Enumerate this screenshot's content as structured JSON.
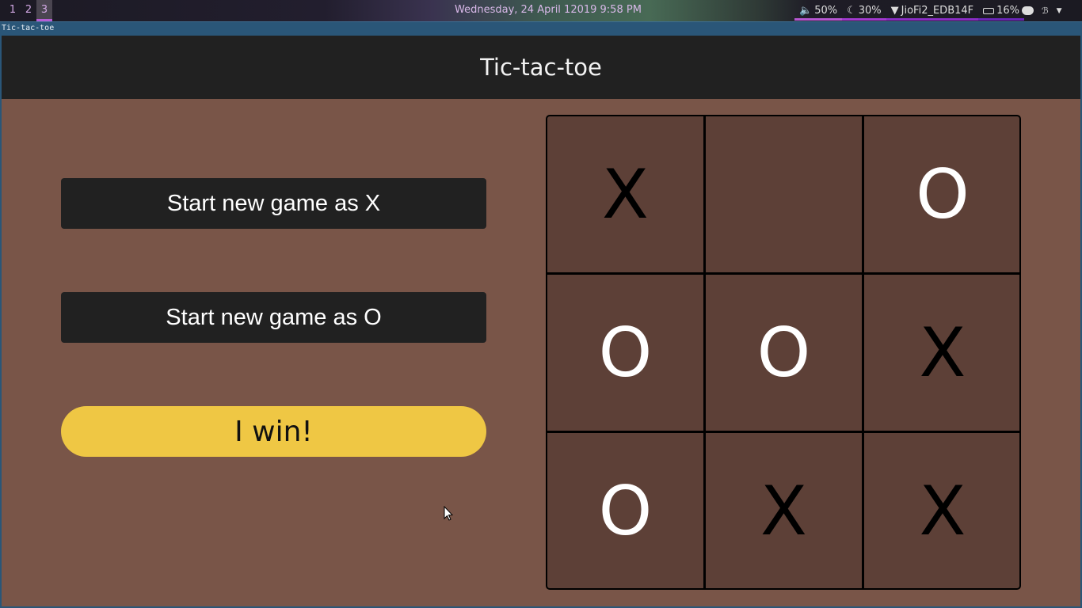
{
  "system_bar": {
    "workspaces": [
      {
        "label": "1",
        "active": false
      },
      {
        "label": "2",
        "active": false
      },
      {
        "label": "3",
        "active": true
      }
    ],
    "clock": "Wednesday, 24 April 12019  9:58 PM",
    "tray": {
      "volume": "50%",
      "brightness": "30%",
      "wifi": "JioFi2_EDB14F",
      "battery": "16%"
    },
    "colors": {
      "accent": "#b65ed6",
      "text": "#d6b6e6"
    }
  },
  "window": {
    "title": "Tic-tac-toe"
  },
  "app": {
    "header_title": "Tic-tac-toe",
    "buttons": {
      "new_game_x": "Start new game as X",
      "new_game_o": "Start new game as O"
    },
    "status": "I win!",
    "board": [
      [
        "X",
        "",
        "O"
      ],
      [
        "O",
        "O",
        "X"
      ],
      [
        "O",
        "X",
        "X"
      ]
    ],
    "colors": {
      "background": "#795548",
      "header": "#212121",
      "cell": "#5d4037",
      "status": "#efc744",
      "x_mark": "#000000",
      "o_mark": "#ffffff"
    }
  }
}
